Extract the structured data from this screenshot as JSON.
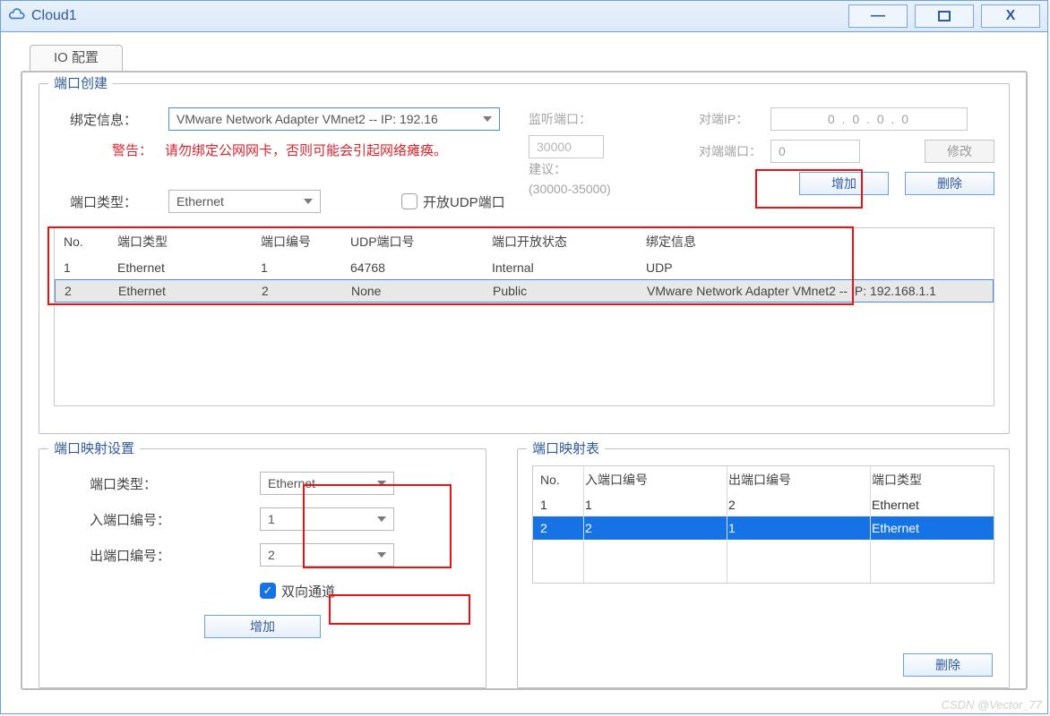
{
  "window": {
    "title": "Cloud1"
  },
  "tabs": {
    "io": "IO 配置"
  },
  "port_create": {
    "legend": "端口创建",
    "bind_label": "绑定信息：",
    "bind_select": "VMware Network Adapter VMnet2 -- IP: 192.16",
    "warn_label": "警告：",
    "warn_text": "请勿绑定公网网卡，否则可能会引起网络瘫痪。",
    "type_label": "端口类型：",
    "type_select": "Ethernet",
    "udp_checkbox": "开放UDP端口",
    "listen_label": "监听端口：",
    "listen_value": "30000",
    "suggest_label": "建议：",
    "suggest_value": "(30000-35000)",
    "peer_ip_label": "对端IP：",
    "peer_ip_value": "0   .   0   .   0   .   0",
    "peer_port_label": "对端端口：",
    "peer_port_value": "0",
    "modify_btn": "修改",
    "add_btn": "增加",
    "del_btn": "删除"
  },
  "port_table": {
    "headers": [
      "No.",
      "端口类型",
      "端口编号",
      "UDP端口号",
      "端口开放状态",
      "绑定信息"
    ],
    "rows": [
      {
        "no": "1",
        "type": "Ethernet",
        "pno": "1",
        "udp": "64768",
        "open": "Internal",
        "bind": "UDP"
      },
      {
        "no": "2",
        "type": "Ethernet",
        "pno": "2",
        "udp": "None",
        "open": "Public",
        "bind": "VMware Network Adapter VMnet2 -- IP: 192.168.1.1"
      }
    ]
  },
  "map_settings": {
    "legend": "端口映射设置",
    "type_label": "端口类型：",
    "type_select": "Ethernet",
    "in_label": "入端口编号：",
    "in_select": "1",
    "out_label": "出端口编号：",
    "out_select": "2",
    "bidi_label": "双向通道",
    "add_btn": "增加"
  },
  "map_table": {
    "legend": "端口映射表",
    "headers": [
      "No.",
      "入端口编号",
      "出端口编号",
      "端口类型"
    ],
    "rows": [
      {
        "no": "1",
        "in": "1",
        "out": "2",
        "type": "Ethernet",
        "selected": false
      },
      {
        "no": "2",
        "in": "2",
        "out": "1",
        "type": "Ethernet",
        "selected": true
      }
    ],
    "del_btn": "删除"
  },
  "watermark": "CSDN @Vector_77"
}
